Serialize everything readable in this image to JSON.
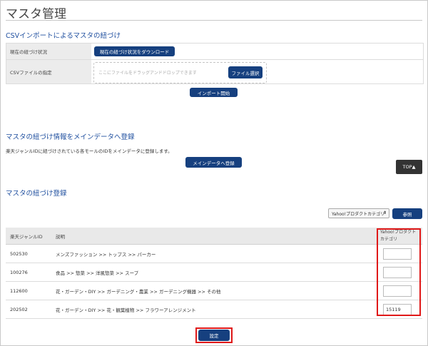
{
  "page": {
    "title": "マスタ管理"
  },
  "import_section": {
    "title": "CSVインポートによるマスタの紐づけ",
    "status_label": "現在の紐づけ状況",
    "download_button": "現在の紐づけ状況をダウンロード",
    "file_label": "CSVファイルの指定",
    "dropzone_placeholder": "ここにファイルをドラッグアンドドロップできます",
    "file_select_button": "ファイル選択",
    "import_button": "インポート開始"
  },
  "register_section": {
    "title": "マスタの紐づけ情報をメインデータへ登録",
    "description": "楽天ジャンルIDに紐づけされている各モールのIDをメインデータに登録します。",
    "register_button": "メインデータへ登録"
  },
  "top_button": "TOP▲",
  "mapping_section": {
    "title": "マスタの紐づけ登録",
    "select_value": "Yahoo!プロダクトカテゴリ",
    "browse_button": "参照",
    "headers": {
      "genre_id": "楽天ジャンルID",
      "description": "説明",
      "category": "Yahoo!プロダクトカテゴリ"
    },
    "rows": [
      {
        "id": "502530",
        "desc": "メンズファッション >> トップス >> パーカー",
        "value": ""
      },
      {
        "id": "100276",
        "desc": "食品 >> 惣菜 >> 洋風惣菜 >> スープ",
        "value": ""
      },
      {
        "id": "112600",
        "desc": "花・ガーデン・DIY >> ガーデニング・農業 >> ガーデニング機器 >> その他",
        "value": ""
      },
      {
        "id": "202502",
        "desc": "花・ガーデン・DIY >> 花・観葉植物 >> フラワーアレンジメント",
        "value": "15119"
      }
    ],
    "submit_button": "設定"
  },
  "colors": {
    "accent": "#16407f",
    "title": "#1f4f9f",
    "highlight": "#e01818"
  }
}
